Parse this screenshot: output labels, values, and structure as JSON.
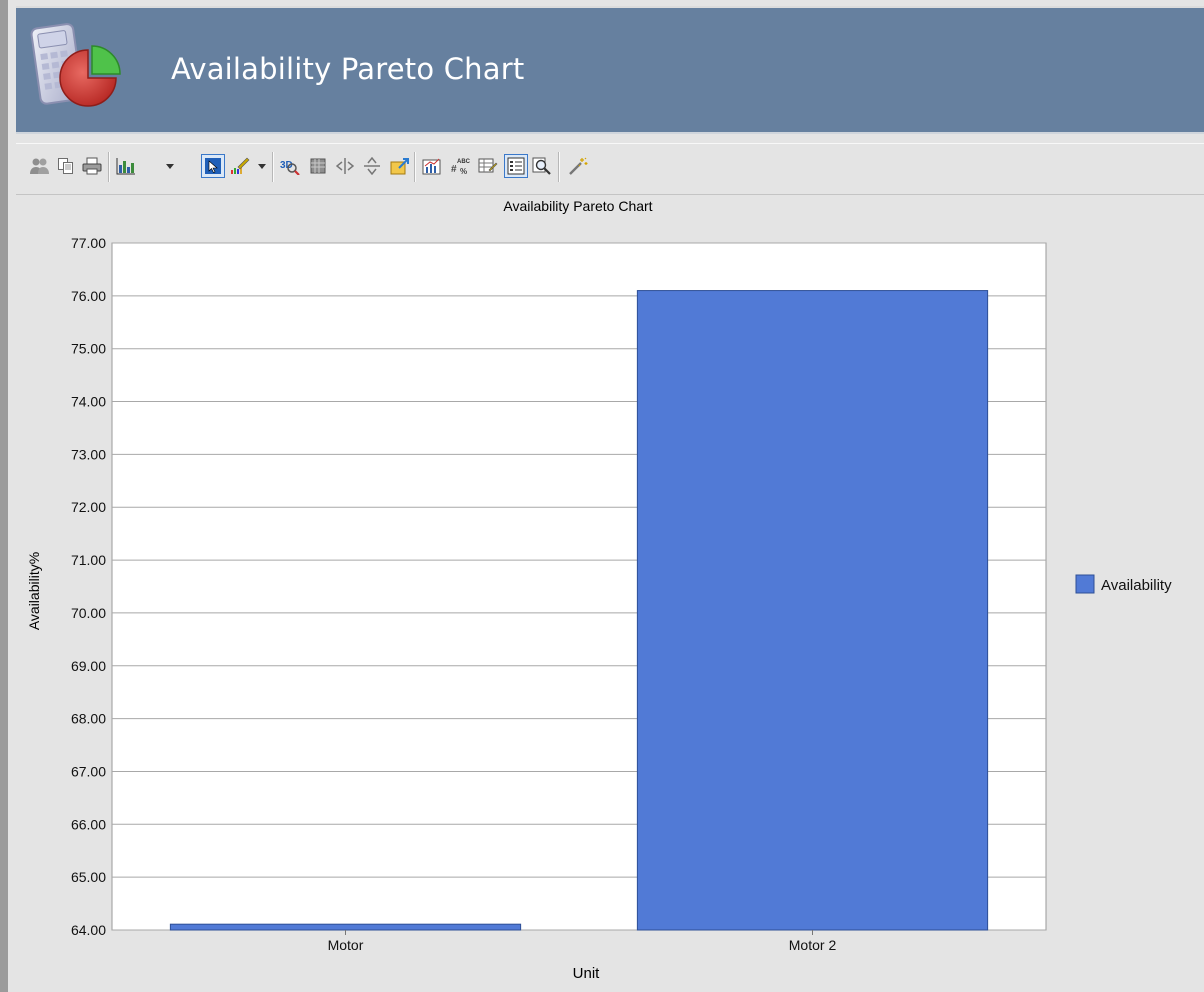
{
  "header": {
    "title": "Availability Pareto Chart"
  },
  "toolbar": {
    "buttons": [
      {
        "name": "people-icon"
      },
      {
        "name": "copy-icon"
      },
      {
        "name": "print-icon"
      },
      {
        "name": "chart-type-icon",
        "dropdown": true
      },
      {
        "name": "pointer-select-icon",
        "selected": true
      },
      {
        "name": "palette-icon",
        "dropdown": true
      },
      {
        "name": "3d-toggle-icon"
      },
      {
        "name": "grid-icon"
      },
      {
        "name": "vertical-split-icon"
      },
      {
        "name": "horizontal-split-icon"
      },
      {
        "name": "export-icon"
      },
      {
        "name": "chart-properties-icon"
      },
      {
        "name": "data-labels-icon"
      },
      {
        "name": "data-table-icon"
      },
      {
        "name": "legend-icon",
        "selected": true
      },
      {
        "name": "zoom-icon"
      },
      {
        "name": "wizard-icon"
      }
    ]
  },
  "colors": {
    "header": "#66809f",
    "bar": "#517ad6",
    "selected": "#3a78c9"
  },
  "chart_data": {
    "type": "bar",
    "title": "Availability Pareto Chart",
    "xlabel": "Unit",
    "ylabel": "Availability%",
    "categories": [
      "Motor",
      "Motor 2"
    ],
    "series": [
      {
        "name": "Availability",
        "values": [
          64.11,
          76.1
        ]
      }
    ],
    "ylim": [
      64,
      77
    ],
    "yticks": [
      "77.00",
      "76.00",
      "75.00",
      "74.00",
      "73.00",
      "72.00",
      "71.00",
      "70.00",
      "69.00",
      "68.00",
      "67.00",
      "66.00",
      "65.00",
      "64.00"
    ],
    "grid": true,
    "legend_position": "right"
  }
}
